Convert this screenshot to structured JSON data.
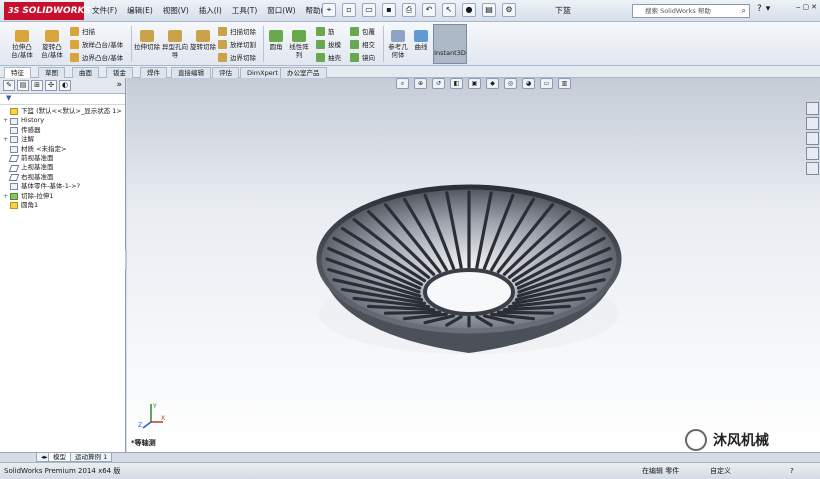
{
  "app": {
    "logo_text": "SOLIDWORKS",
    "document_title": "下篮"
  },
  "menu": [
    "文件(F)",
    "编辑(E)",
    "视图(V)",
    "插入(I)",
    "工具(T)",
    "窗口(W)",
    "帮助(H)"
  ],
  "search": {
    "placeholder": "搜索 SolidWorks 帮助"
  },
  "commands": {
    "extrude_boss": "拉伸凸台/基体",
    "revolve_boss": "旋转凸台/基体",
    "sweep": "扫描",
    "loft": "放样凸台/基体",
    "boundary_boss": "边界凸台/基体",
    "extrude_cut": "拉伸切除",
    "hole_wizard": "异型孔向导",
    "revolve_cut": "旋转切除",
    "swept_cut": "扫描切除",
    "lofted_cut": "放样切割",
    "boundary_cut": "边界切除",
    "fillet": "圆角",
    "linear_pattern": "线性阵列",
    "rib": "筋",
    "draft": "拔模",
    "shell": "抽壳",
    "wrap": "包覆",
    "intersect": "相交",
    "mirror": "镜向",
    "ref_geometry": "参考几何体",
    "curves": "曲线",
    "instant3d": "Instant3D"
  },
  "tabs": [
    "特征",
    "草图",
    "曲面",
    "钣金",
    "焊件",
    "直接编辑",
    "评估",
    "DimXpert",
    "办公室产品"
  ],
  "tree": [
    {
      "label": "下篮  (默认<<默认>_显示状态 1>",
      "icon": "part-icon",
      "exp": ""
    },
    {
      "label": "History",
      "icon": "history-icon",
      "exp": "+"
    },
    {
      "label": "传感器",
      "icon": "sensor-icon",
      "exp": ""
    },
    {
      "label": "注解",
      "icon": "annotation-icon",
      "exp": "+"
    },
    {
      "label": "材质 <未指定>",
      "icon": "material-icon",
      "exp": ""
    },
    {
      "label": "前视基准面",
      "icon": "plane-icon",
      "exp": ""
    },
    {
      "label": "上视基准面",
      "icon": "plane-icon",
      "exp": ""
    },
    {
      "label": "右视基准面",
      "icon": "plane-icon",
      "exp": ""
    },
    {
      "label": "基体零件-基体-1->?",
      "icon": "base-part-icon",
      "exp": ""
    },
    {
      "label": "切除-拉伸1",
      "icon": "cut-extrude-icon",
      "exp": "+"
    },
    {
      "label": "圆角1",
      "icon": "fillet-icon",
      "exp": ""
    }
  ],
  "viewport": {
    "view_name": "*等轴测",
    "watermark_text": "沐风机械",
    "triad_labels": [
      "X",
      "Y",
      "Z"
    ]
  },
  "model_tabs": [
    "模型",
    "运动算例 1"
  ],
  "status": {
    "product": "SolidWorks Premium 2014 x64 版",
    "mode": "在编辑 零件",
    "units": "自定义"
  }
}
